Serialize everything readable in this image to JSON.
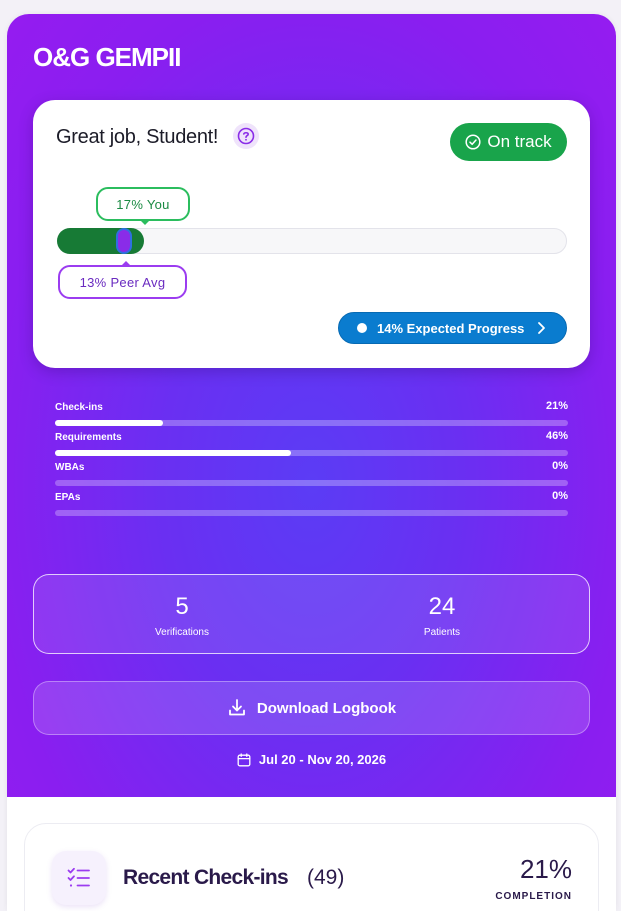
{
  "app": {
    "title": "O&G GEMPII"
  },
  "progress_card": {
    "greeting": "Great job, Student!",
    "status_label": "On track",
    "you_label": "17% You",
    "you_value": 0.17,
    "peer_label": "13% Peer Avg",
    "peer_value": 0.13,
    "expected_label": "14% Expected Progress",
    "colors": {
      "you": "#177a35",
      "peer": "#9b3cf0",
      "status": "#19a44b",
      "expected": "#0a7ccf"
    }
  },
  "metrics": [
    {
      "label": "Check-ins",
      "percent_label": "21%",
      "value": 0.21
    },
    {
      "label": "Requirements",
      "percent_label": "46%",
      "value": 0.46
    },
    {
      "label": "WBAs",
      "percent_label": "0%",
      "value": 0
    },
    {
      "label": "EPAs",
      "percent_label": "0%",
      "value": 0
    }
  ],
  "stats": {
    "verifications": {
      "value": "5",
      "label": "Verifications"
    },
    "patients": {
      "value": "24",
      "label": "Patients"
    }
  },
  "download": {
    "label": "Download Logbook"
  },
  "date_range": "Jul 20 - Nov 20, 2026",
  "recent_checkins": {
    "title": "Recent Check-ins",
    "count": "(49)",
    "completion_value": "21%",
    "completion_label": "COMPLETION"
  }
}
